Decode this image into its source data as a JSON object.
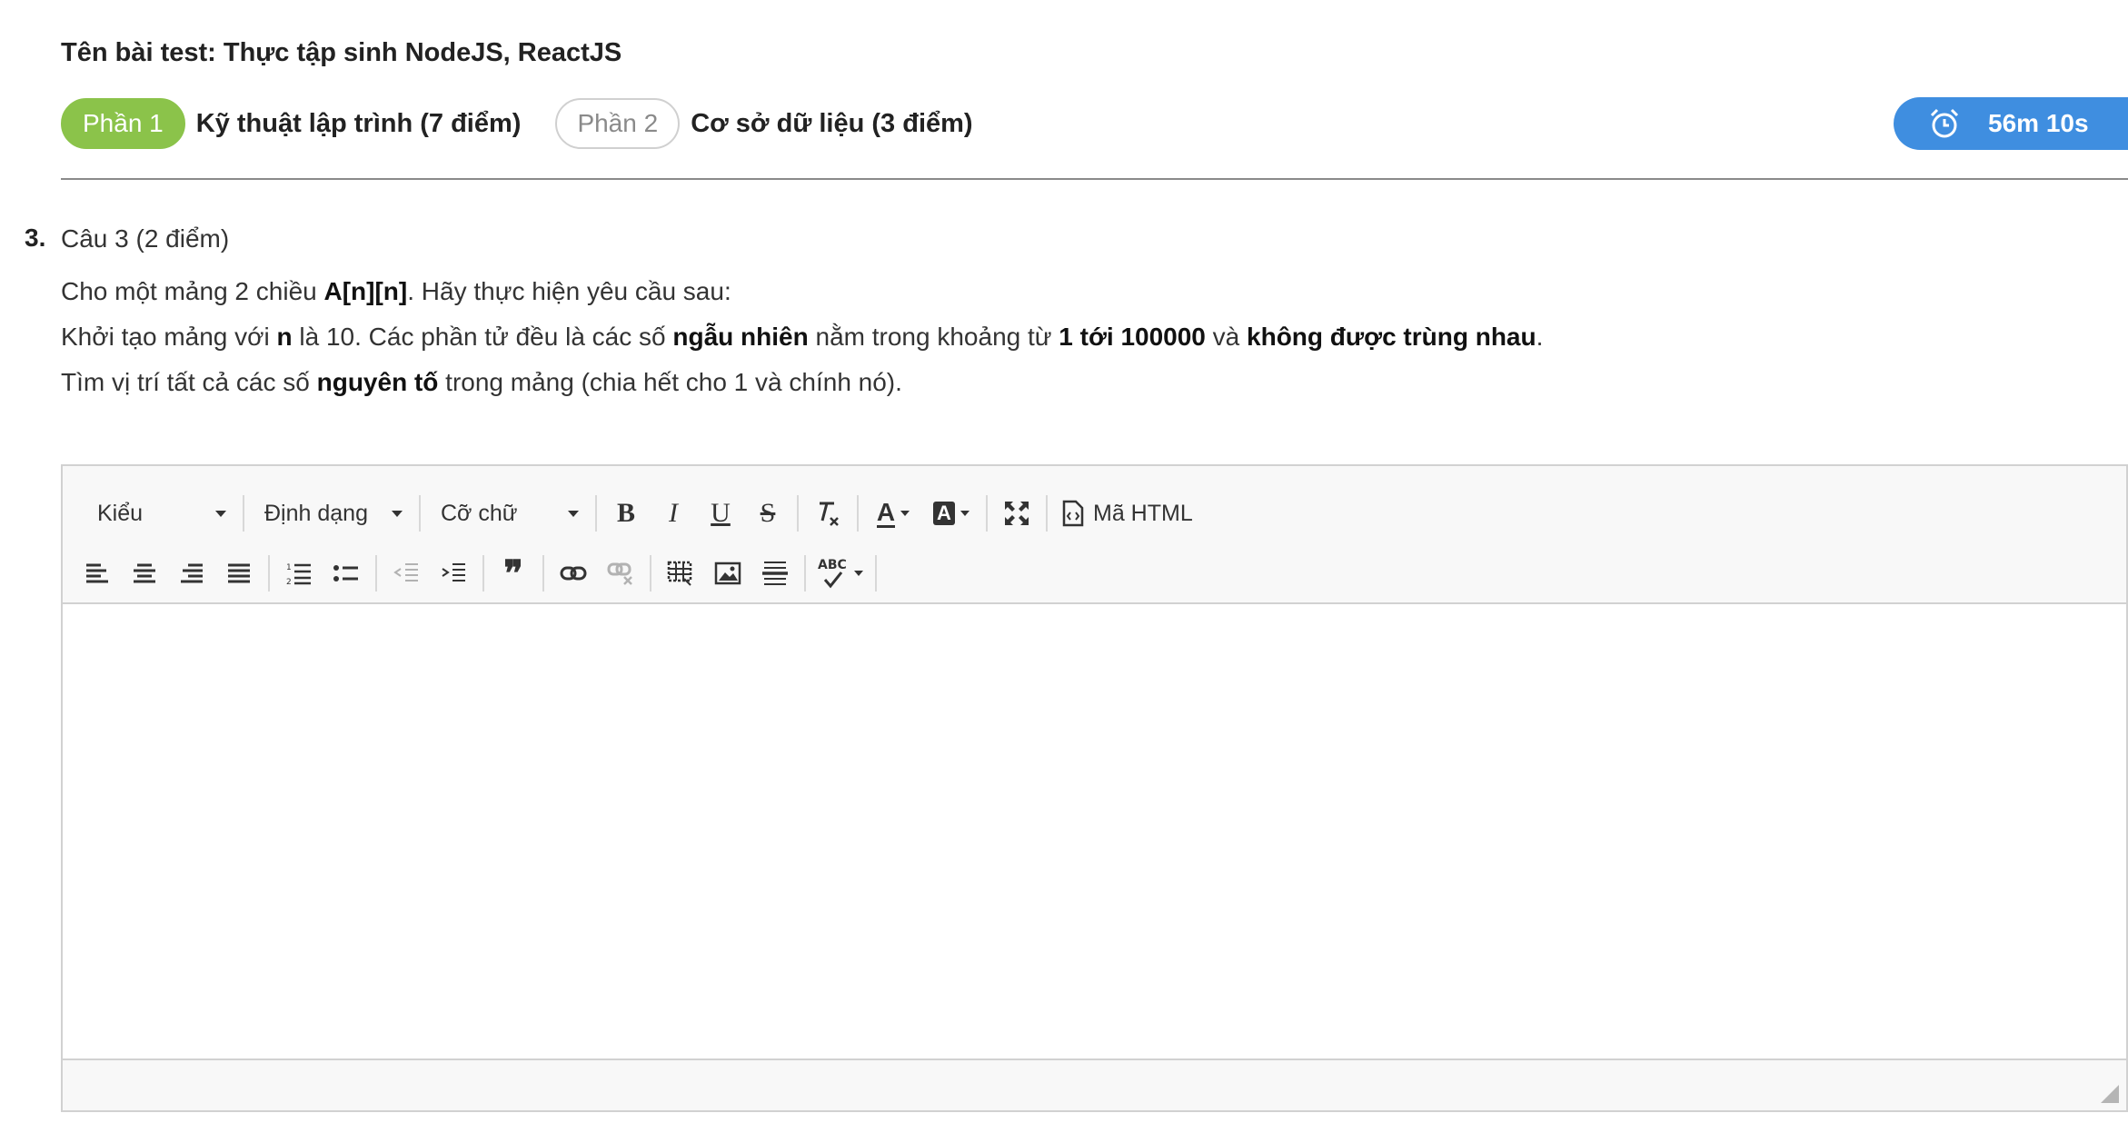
{
  "test_title": "Tên bài test: Thực tập sinh NodeJS, ReactJS",
  "parts": [
    {
      "badge": "Phần 1",
      "label": "Kỹ thuật lập trình (7 điểm)",
      "active": true
    },
    {
      "badge": "Phần 2",
      "label": "Cơ sở dữ liệu (3 điểm)",
      "active": false
    }
  ],
  "timer": {
    "icon": "alarm-clock-icon",
    "time": "56m 10s"
  },
  "question": {
    "number": "3.",
    "title": "Câu 3 (2 điểm)",
    "line1": {
      "a": "Cho một mảng 2 chiều ",
      "b1": "A[n][n]",
      "c": ". Hãy thực hiện yêu cầu sau:"
    },
    "line2": {
      "a": "Khởi tạo mảng với ",
      "b1": "n",
      "c": " là 10. Các phần tử đều là các số ",
      "b2": "ngẫu nhiên",
      "d": " nằm trong khoảng từ ",
      "b3": "1 tới 100000",
      "e": " và ",
      "b4": "không được trùng nhau",
      "f": "."
    },
    "line3": {
      "a": "Tìm vị trí tất cả các số ",
      "b1": "nguyên tố",
      "c": " trong mảng (chia hết cho 1 và chính nó)."
    }
  },
  "editor": {
    "style_combo": "Kiểu",
    "format_combo": "Định dạng",
    "size_combo": "Cỡ chữ",
    "source_button": "Mã HTML",
    "bold": "B",
    "italic": "I",
    "underline": "U",
    "strike": "S",
    "text_color_glyph": "A",
    "bg_color_glyph": "A",
    "blockquote_glyph": "❞",
    "spellcheck_glyph": "ABC",
    "content": ""
  },
  "colors": {
    "active_part": "#8bc34a",
    "timer_bg": "#3f8ee0"
  }
}
